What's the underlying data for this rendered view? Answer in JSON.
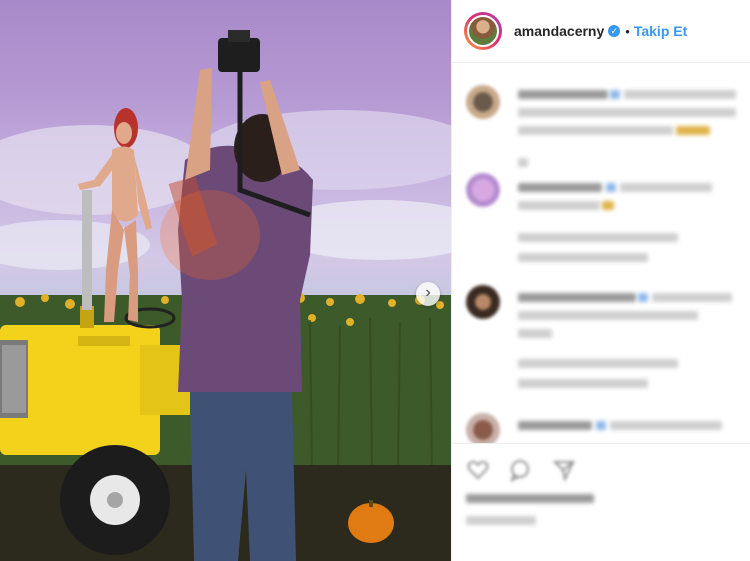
{
  "post": {
    "image_alt": "Photo of a photographer shooting a model standing on a yellow tractor in a sunflower field",
    "carousel_next_icon": "chevron-right-icon"
  },
  "header": {
    "username": "amandacerny",
    "verified_icon": "verified-badge-icon",
    "separator": "•",
    "follow_label": "Takip Et"
  },
  "comments": {
    "blurred": true,
    "count_visible": 4
  },
  "actions": {
    "icons": [
      "heart-icon",
      "comment-icon",
      "share-icon"
    ],
    "likes_blurred": true,
    "timestamp_blurred": true
  },
  "colors": {
    "accent": "#3897f0",
    "tractor": "#f2d21b",
    "border": "#efefef"
  }
}
